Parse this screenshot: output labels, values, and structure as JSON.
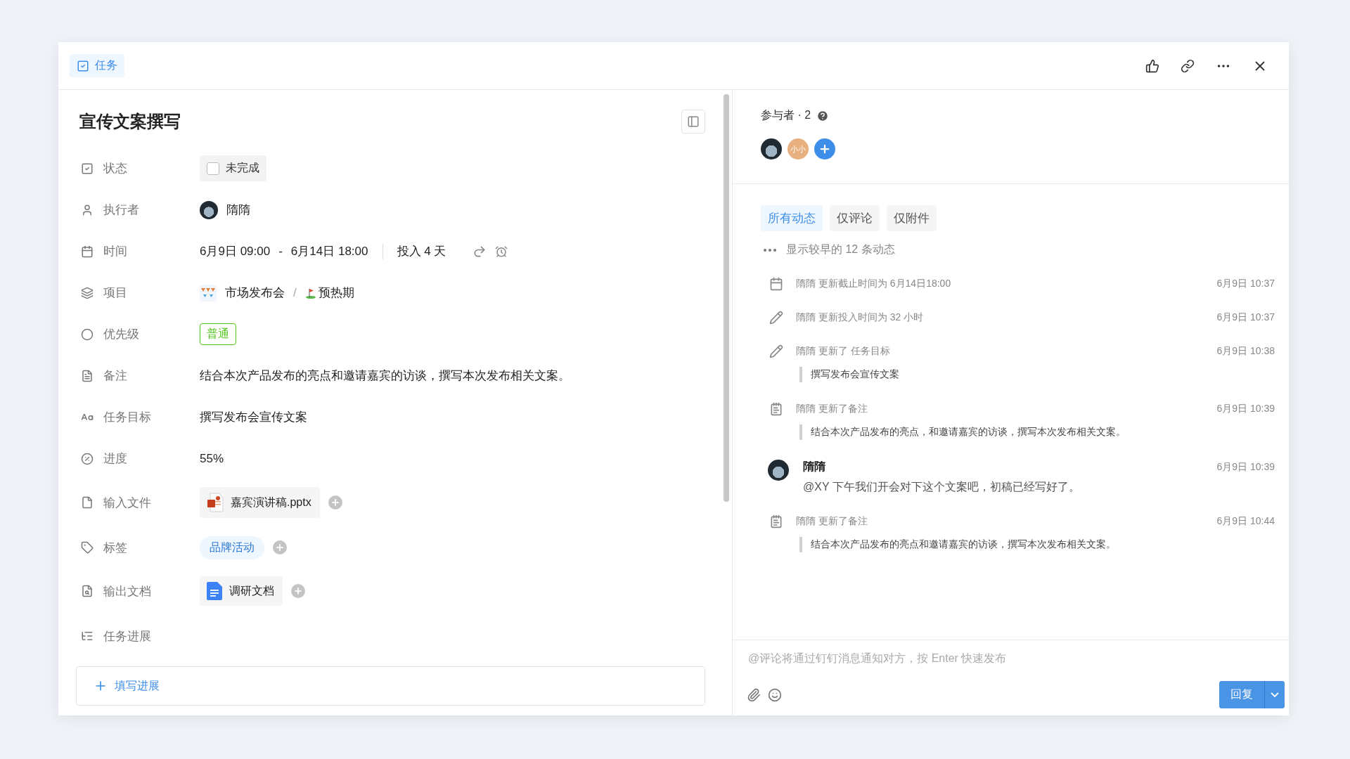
{
  "header": {
    "tab": {
      "label": "任务"
    }
  },
  "task": {
    "title": "宣传文案撰写",
    "fields": [
      {
        "kind": "status",
        "label": "状态",
        "value": "未完成",
        "checked": false
      },
      {
        "kind": "person",
        "label": "执行者",
        "value": "隋隋"
      },
      {
        "kind": "time",
        "label": "时间",
        "start": "6月9日 09:00",
        "separator": "-",
        "end": "6月14日 18:00",
        "effort": "投入 4 天"
      },
      {
        "kind": "project",
        "label": "项目",
        "project": "市场发布会",
        "separator": "/",
        "phase": "预热期"
      },
      {
        "kind": "priority",
        "label": "优先级",
        "value": "普通"
      },
      {
        "kind": "text",
        "label": "备注",
        "value": "结合本次产品发布的亮点和邀请嘉宾的访谈，撰写本次发布相关文案。"
      },
      {
        "kind": "text",
        "label": "任务目标",
        "value": "撰写发布会宣传文案"
      },
      {
        "kind": "text",
        "label": "进度",
        "value": "55%"
      },
      {
        "kind": "file",
        "label": "输入文件",
        "value": "嘉宾演讲稿.pptx"
      },
      {
        "kind": "tag",
        "label": "标签",
        "value": "品牌活动"
      },
      {
        "kind": "doc",
        "label": "输出文档",
        "value": "调研文档"
      },
      {
        "kind": "heading",
        "label": "任务进展"
      }
    ],
    "progress_button": "填写进展"
  },
  "participants": {
    "label": "参与者 · 2",
    "members": [
      {
        "kind": "photo"
      },
      {
        "kind": "initials",
        "text": "小小"
      }
    ]
  },
  "filters": [
    {
      "label": "所有动态",
      "selected": true
    },
    {
      "label": "仅评论",
      "selected": false
    },
    {
      "label": "仅附件",
      "selected": false
    }
  ],
  "older": "显示较早的 12 条动态",
  "activities": [
    {
      "kind": "deadline",
      "text": "隋隋 更新截止时间为 6月14日18:00",
      "time": "6月9日 10:37"
    },
    {
      "kind": "edit",
      "text": "隋隋 更新投入时间为 32 小时",
      "time": "6月9日 10:37"
    },
    {
      "kind": "edit",
      "text": "隋隋 更新了 任务目标",
      "time": "6月9日 10:38",
      "quote": "撰写发布会宣传文案"
    },
    {
      "kind": "note",
      "text": "隋隋 更新了备注",
      "time": "6月9日 10:39",
      "quote": "结合本次产品发布的亮点，和邀请嘉宾的访谈，撰写本次发布相关文案。"
    },
    {
      "kind": "comment",
      "author": "隋隋",
      "text": "@XY 下午我们开会对下这个文案吧，初稿已经写好了。",
      "time": "6月9日 10:39"
    },
    {
      "kind": "note",
      "text": "隋隋 更新了备注",
      "time": "6月9日 10:44",
      "quote": "结合本次产品发布的亮点和邀请嘉宾的访谈，撰写本次发布相关文案。"
    }
  ],
  "composer": {
    "placeholder": "@评论将通过钉钉消息通知对方，按 Enter 快速发布",
    "reply": "回复"
  }
}
